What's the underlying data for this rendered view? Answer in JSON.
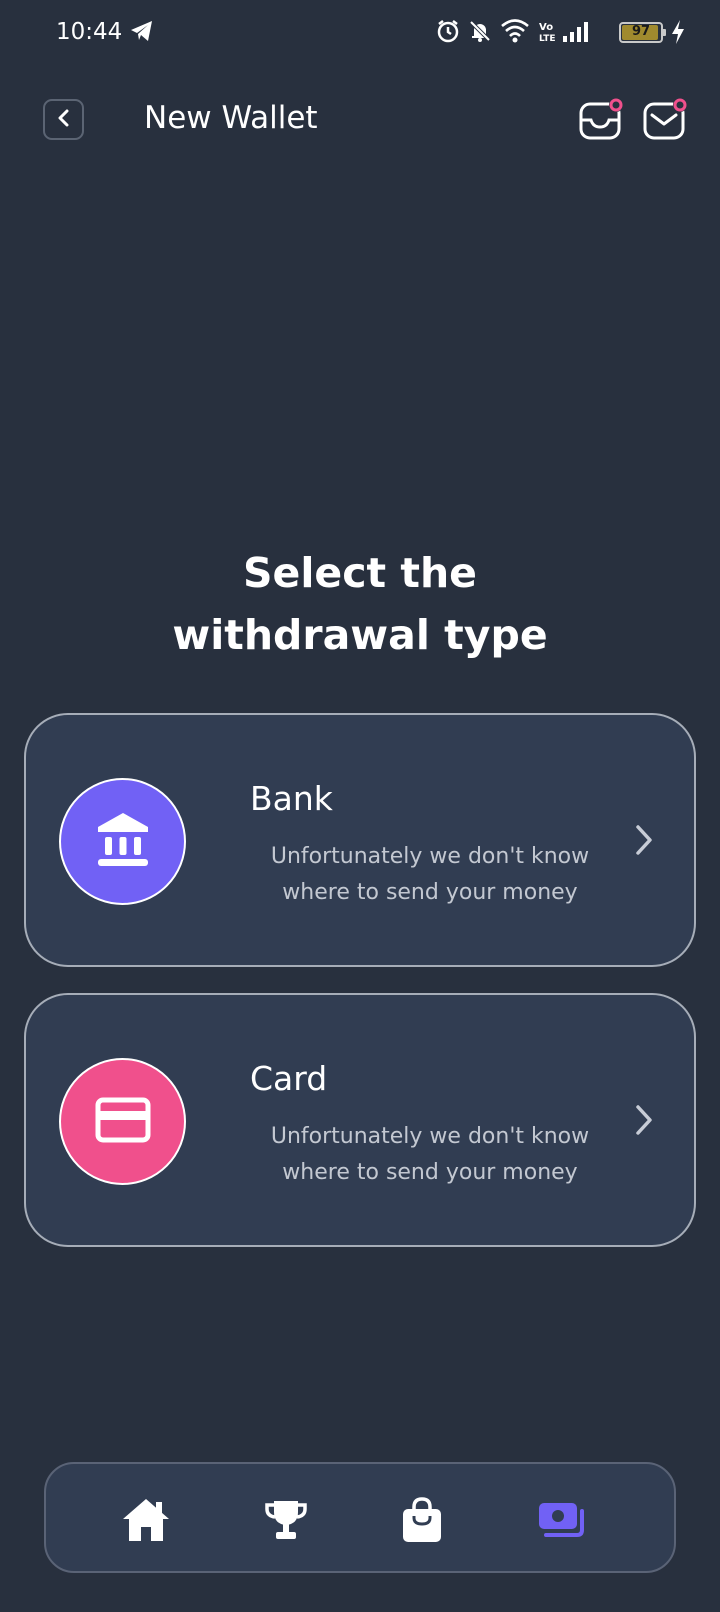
{
  "status_bar": {
    "time": "10:44",
    "battery": "97",
    "icons": [
      "telegram-icon",
      "alarm-icon",
      "bell-off-icon",
      "wifi-icon",
      "volte-icon",
      "signal-icon",
      "battery-icon",
      "charging-icon"
    ]
  },
  "header": {
    "title": "New Wallet",
    "icons": [
      "back-icon",
      "inbox-icon",
      "mail-icon"
    ]
  },
  "heading": {
    "line1": "Select the",
    "line2": "withdrawal type"
  },
  "options": [
    {
      "title": "Bank",
      "desc_line1": "Unfortunately we don't know",
      "desc_line2": "where to send your money",
      "icon": "bank-icon",
      "color": "#7161f5"
    },
    {
      "title": "Card",
      "desc_line1": "Unfortunately we don't know",
      "desc_line2": "where to send your money",
      "icon": "card-icon",
      "color": "#f0508c"
    }
  ],
  "nav": {
    "items": [
      "home-icon",
      "trophy-icon",
      "shopping-bag-icon",
      "wallet-icon"
    ],
    "active": "wallet-icon",
    "active_color": "#7161f5"
  },
  "colors": {
    "background": "#28303e",
    "card": "#313d52",
    "badge": "#f0508c"
  }
}
